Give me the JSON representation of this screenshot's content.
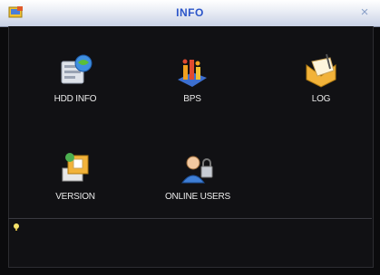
{
  "window": {
    "title": "INFO",
    "close_label": "×"
  },
  "menu": {
    "items": [
      {
        "label": "HDD INFO",
        "icon": "hdd-icon"
      },
      {
        "label": "BPS",
        "icon": "bar-chart-icon"
      },
      {
        "label": "LOG",
        "icon": "log-folder-icon"
      },
      {
        "label": "VERSION",
        "icon": "version-box-icon"
      },
      {
        "label": "ONLINE USERS",
        "icon": "online-users-icon"
      }
    ]
  },
  "colors": {
    "title": "#2b55c9",
    "background": "#0b0b0d",
    "label": "#eaeaea"
  }
}
